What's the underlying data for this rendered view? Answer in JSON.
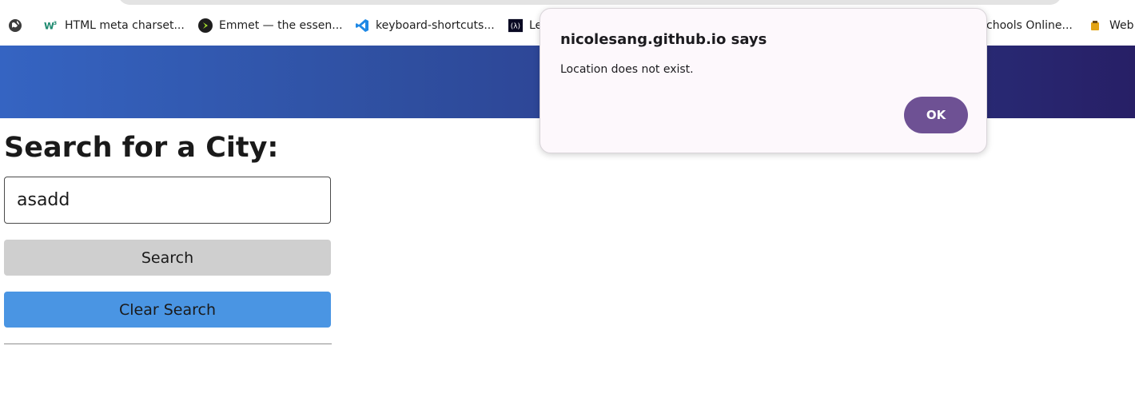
{
  "bookmarks": [
    {
      "label": "",
      "icon": "globe-icon"
    },
    {
      "label": "HTML meta charset...",
      "icon": "w3c-icon"
    },
    {
      "label": "Emmet — the essen...",
      "icon": "emmet-icon"
    },
    {
      "label": "keyboard-shortcuts...",
      "icon": "vscode-icon"
    },
    {
      "label": "Le",
      "icon": "freecodecamp-icon"
    },
    {
      "label": "chools Online...",
      "icon": ""
    },
    {
      "label": "Web",
      "icon": "w3schools-icon"
    }
  ],
  "header": {
    "gradient_start": "#3564c2",
    "gradient_end": "#271f66"
  },
  "search": {
    "title": "Search for a City:",
    "input_value": "asadd",
    "search_button": "Search",
    "clear_button": "Clear Search"
  },
  "dialog": {
    "title": "nicolesang.github.io says",
    "message": "Location does not exist.",
    "ok_label": "OK",
    "ok_color": "#6e5194"
  }
}
